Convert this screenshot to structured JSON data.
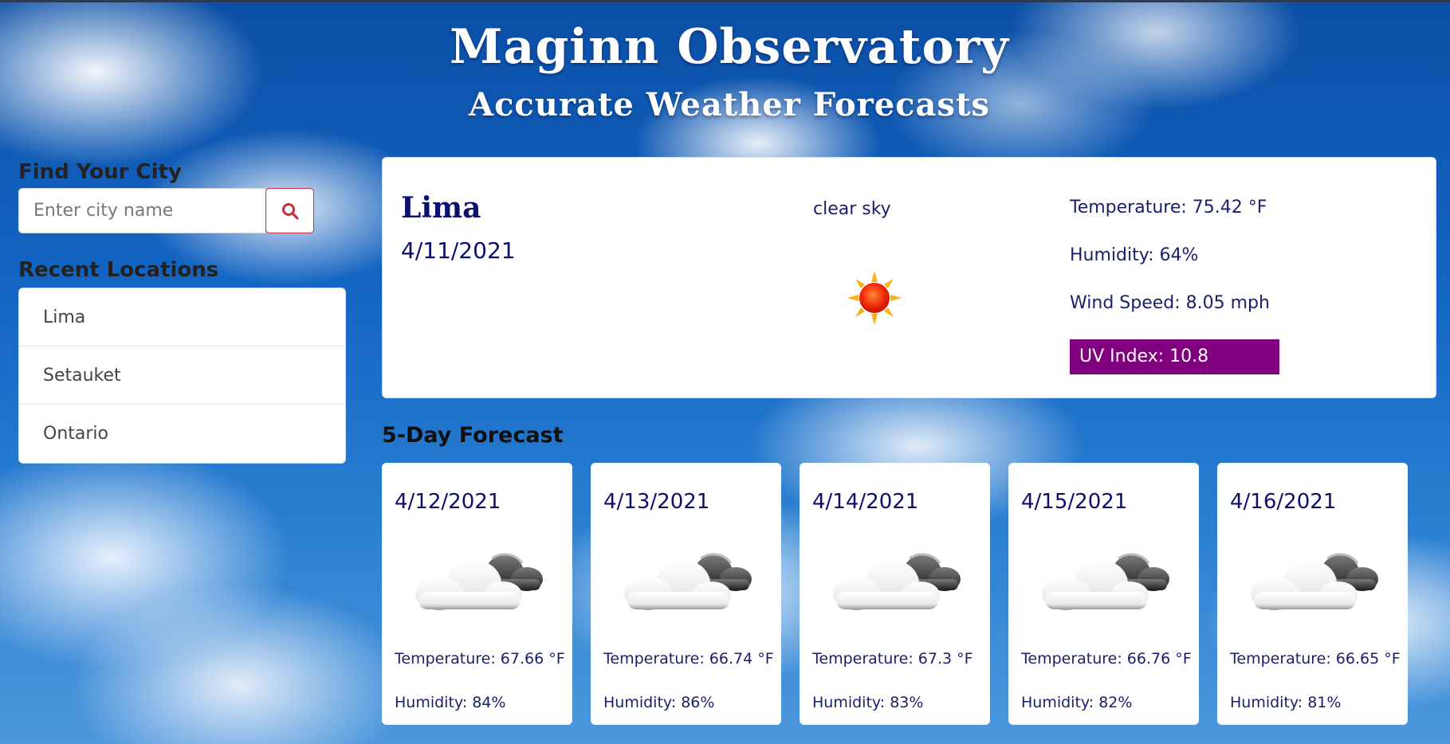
{
  "header": {
    "title": "Maginn Observatory",
    "subtitle": "Accurate Weather Forecasts"
  },
  "sidebar": {
    "find_heading": "Find Your City",
    "search_placeholder": "Enter city name",
    "search_value": "",
    "search_icon": "search-icon",
    "recent_heading": "Recent Locations",
    "recent": [
      {
        "label": "Lima"
      },
      {
        "label": "Setauket"
      },
      {
        "label": "Ontario"
      }
    ]
  },
  "current": {
    "city": "Lima",
    "date": "4/11/2021",
    "description": "clear sky",
    "icon": "sun-icon",
    "temperature": "Temperature: 75.42 °F",
    "humidity": "Humidity: 64%",
    "wind": "Wind Speed: 8.05 mph",
    "uv": "UV Index: 10.8",
    "uv_color": "#800080"
  },
  "forecast": {
    "title": "5-Day Forecast",
    "days": [
      {
        "date": "4/12/2021",
        "icon": "cloud-icon",
        "temp": "Temperature: 67.66 °F",
        "humidity": "Humidity: 84%"
      },
      {
        "date": "4/13/2021",
        "icon": "cloud-icon",
        "temp": "Temperature: 66.74 °F",
        "humidity": "Humidity: 86%"
      },
      {
        "date": "4/14/2021",
        "icon": "cloud-icon",
        "temp": "Temperature: 67.3 °F",
        "humidity": "Humidity: 83%"
      },
      {
        "date": "4/15/2021",
        "icon": "cloud-icon",
        "temp": "Temperature: 66.76 °F",
        "humidity": "Humidity: 82%"
      },
      {
        "date": "4/16/2021",
        "icon": "cloud-icon",
        "temp": "Temperature: 66.65 °F",
        "humidity": "Humidity: 81%"
      }
    ]
  },
  "colors": {
    "accent_text": "#0b0f6e",
    "search_button_border": "#c7313d"
  }
}
